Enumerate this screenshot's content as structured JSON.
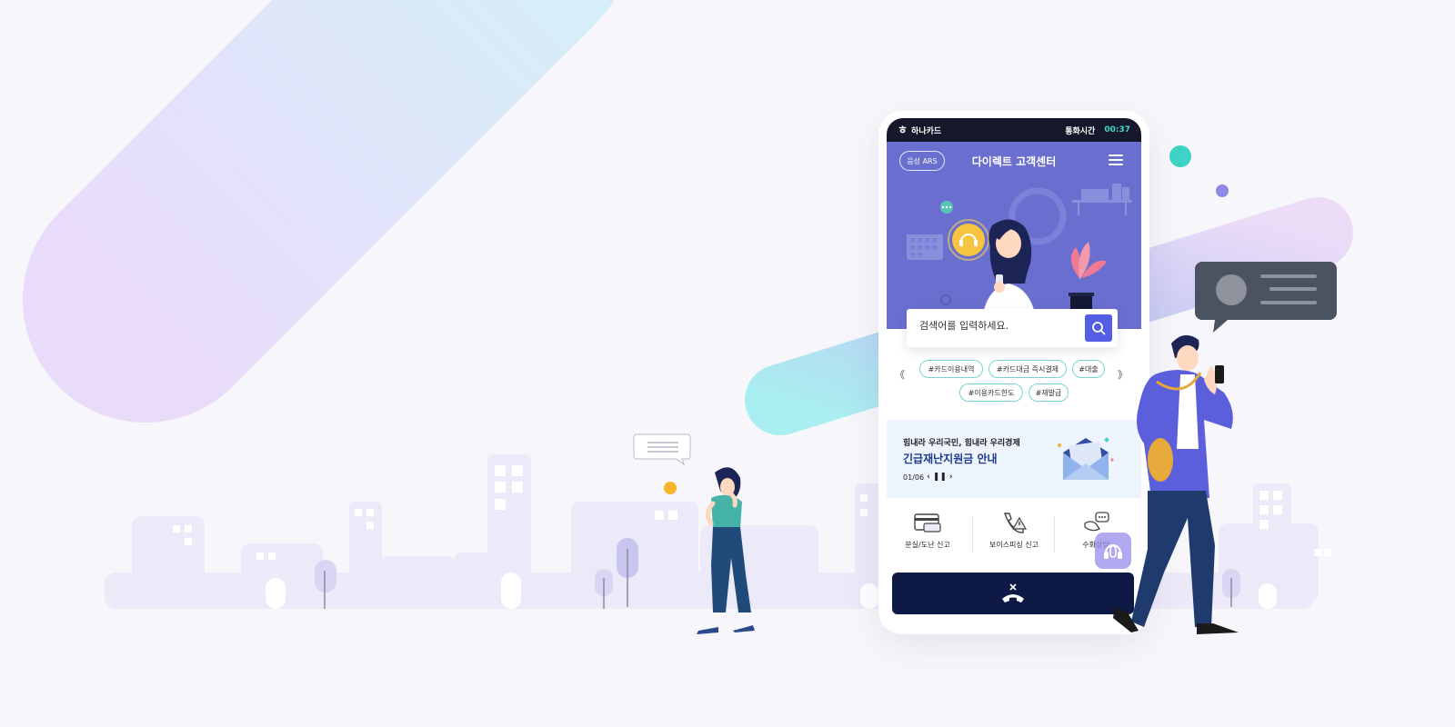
{
  "statusbar": {
    "brand": "하나카드",
    "call_label": "통화시간",
    "call_time": "00:37"
  },
  "header": {
    "ars_button": "음성 ARS",
    "title": "다이렉트 고객센터"
  },
  "search": {
    "placeholder": "검색어를 입력하세요."
  },
  "tags": [
    "#카드이용내역",
    "#카드대금 즉시결제",
    "#대출",
    "#이용카드한도",
    "#재발급"
  ],
  "banner": {
    "subtitle": "힘내라 우리국민, 힘내라 우리경제",
    "title": "긴급재난지원금 안내",
    "page": "01/06"
  },
  "quick_menu": [
    {
      "label": "분실/도난 신고",
      "icon": "card-icon"
    },
    {
      "label": "보이스피싱 신고",
      "icon": "phone-warning-icon"
    },
    {
      "label": "수화상담",
      "icon": "sign-language-icon"
    }
  ],
  "colors": {
    "hero_bg": "#6a6fcf",
    "accent": "#545de3",
    "call_bar": "#0e1a45",
    "tag_border": "#76d6cc",
    "banner_title": "#1c3a8a"
  }
}
